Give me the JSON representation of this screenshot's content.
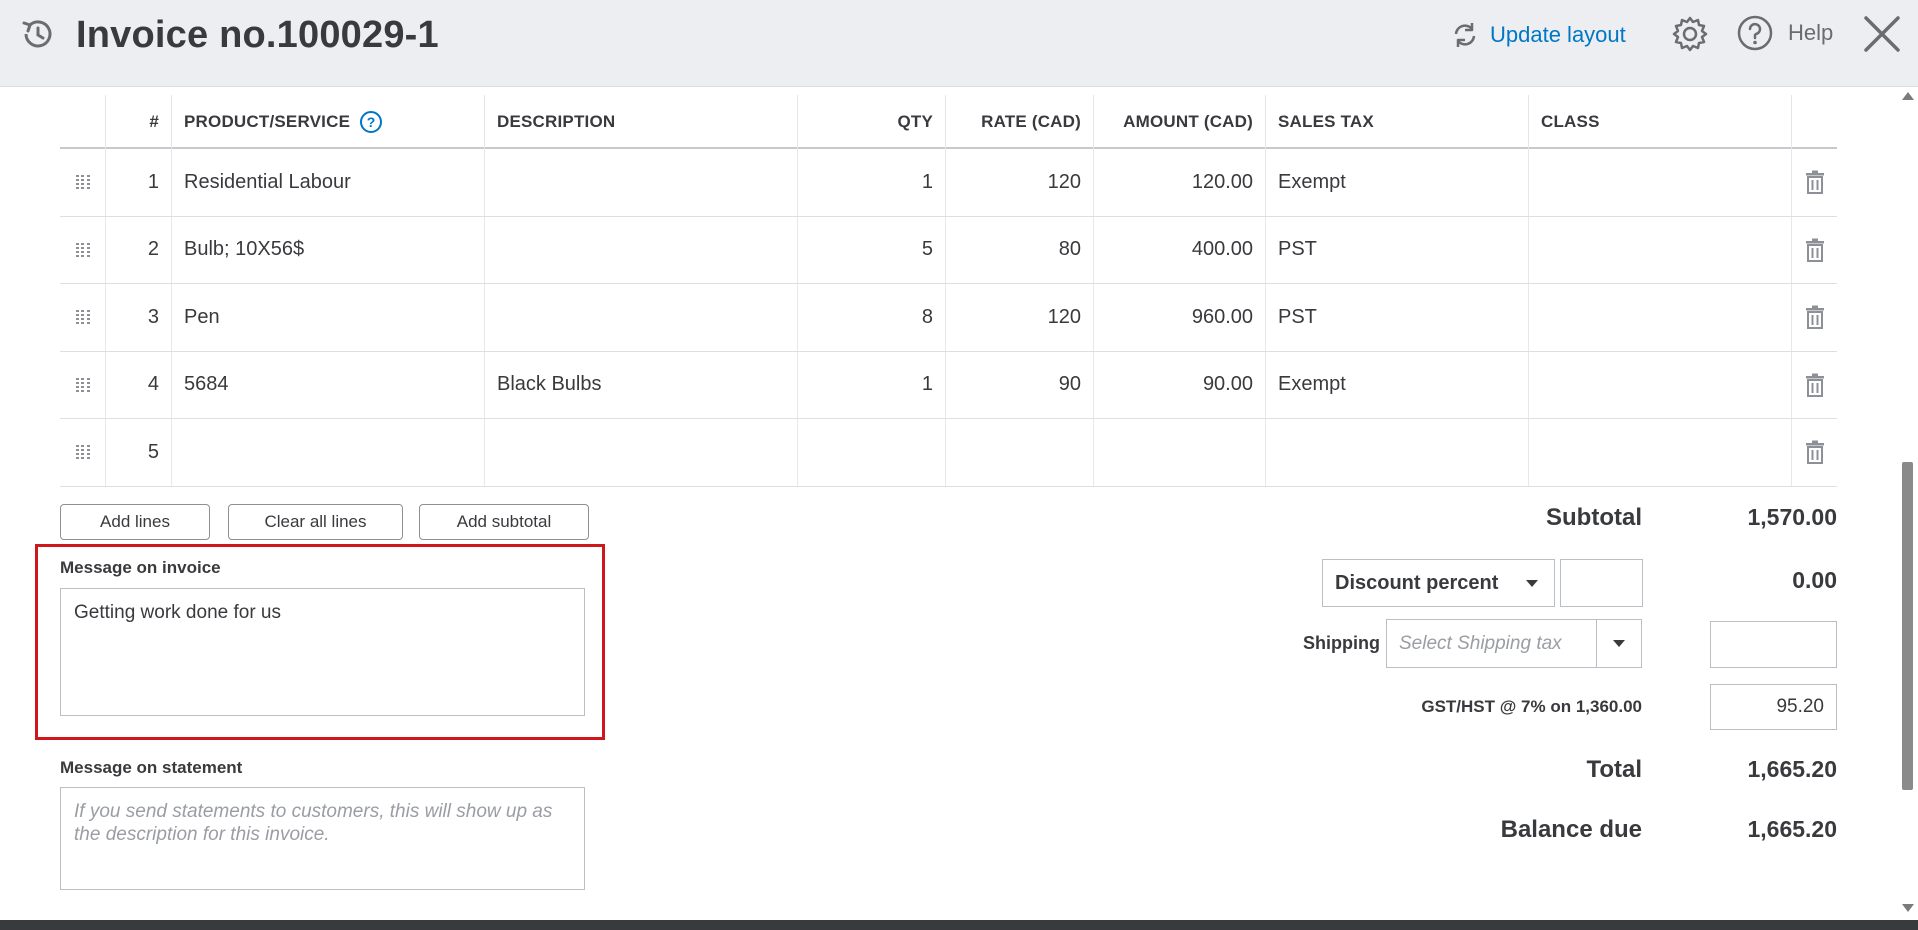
{
  "header": {
    "title": "Invoice no.100029-1",
    "update_layout_label": "Update layout",
    "help_label": "Help"
  },
  "table": {
    "columns": [
      "#",
      "PRODUCT/SERVICE",
      "DESCRIPTION",
      "QTY",
      "RATE (CAD)",
      "AMOUNT (CAD)",
      "SALES TAX",
      "CLASS"
    ],
    "rows": [
      {
        "num": "1",
        "product": "Residential Labour",
        "description": "",
        "qty": "1",
        "rate": "120",
        "amount": "120.00",
        "tax": "Exempt",
        "class": ""
      },
      {
        "num": "2",
        "product": "Bulb; 10X56$",
        "description": "",
        "qty": "5",
        "rate": "80",
        "amount": "400.00",
        "tax": "PST",
        "class": ""
      },
      {
        "num": "3",
        "product": "Pen",
        "description": "",
        "qty": "8",
        "rate": "120",
        "amount": "960.00",
        "tax": "PST",
        "class": ""
      },
      {
        "num": "4",
        "product": "5684",
        "description": "Black Bulbs",
        "qty": "1",
        "rate": "90",
        "amount": "90.00",
        "tax": "Exempt",
        "class": ""
      },
      {
        "num": "5",
        "product": "",
        "description": "",
        "qty": "",
        "rate": "",
        "amount": "",
        "tax": "",
        "class": ""
      }
    ]
  },
  "buttons": {
    "add_lines": "Add lines",
    "clear_all_lines": "Clear all lines",
    "add_subtotal": "Add subtotal"
  },
  "message_invoice": {
    "label": "Message on invoice",
    "value": "Getting work done for us"
  },
  "message_statement": {
    "label": "Message on statement",
    "placeholder": "If you send statements to customers, this will show up as the description for this invoice."
  },
  "totals": {
    "subtotal_label": "Subtotal",
    "subtotal_value": "1,570.00",
    "discount_select": "Discount percent",
    "discount_input": "",
    "discount_value": "0.00",
    "shipping_label": "Shipping",
    "shipping_placeholder": "Select Shipping tax",
    "shipping_input": "",
    "gst_label": "GST/HST @ 7% on 1,360.00",
    "gst_value": "95.20",
    "total_label": "Total",
    "total_value": "1,665.20",
    "balance_label": "Balance due",
    "balance_value": "1,665.20"
  },
  "colors": {
    "accent": "#0077c5",
    "highlight": "#d0171b",
    "header_bg": "#eceef1"
  }
}
